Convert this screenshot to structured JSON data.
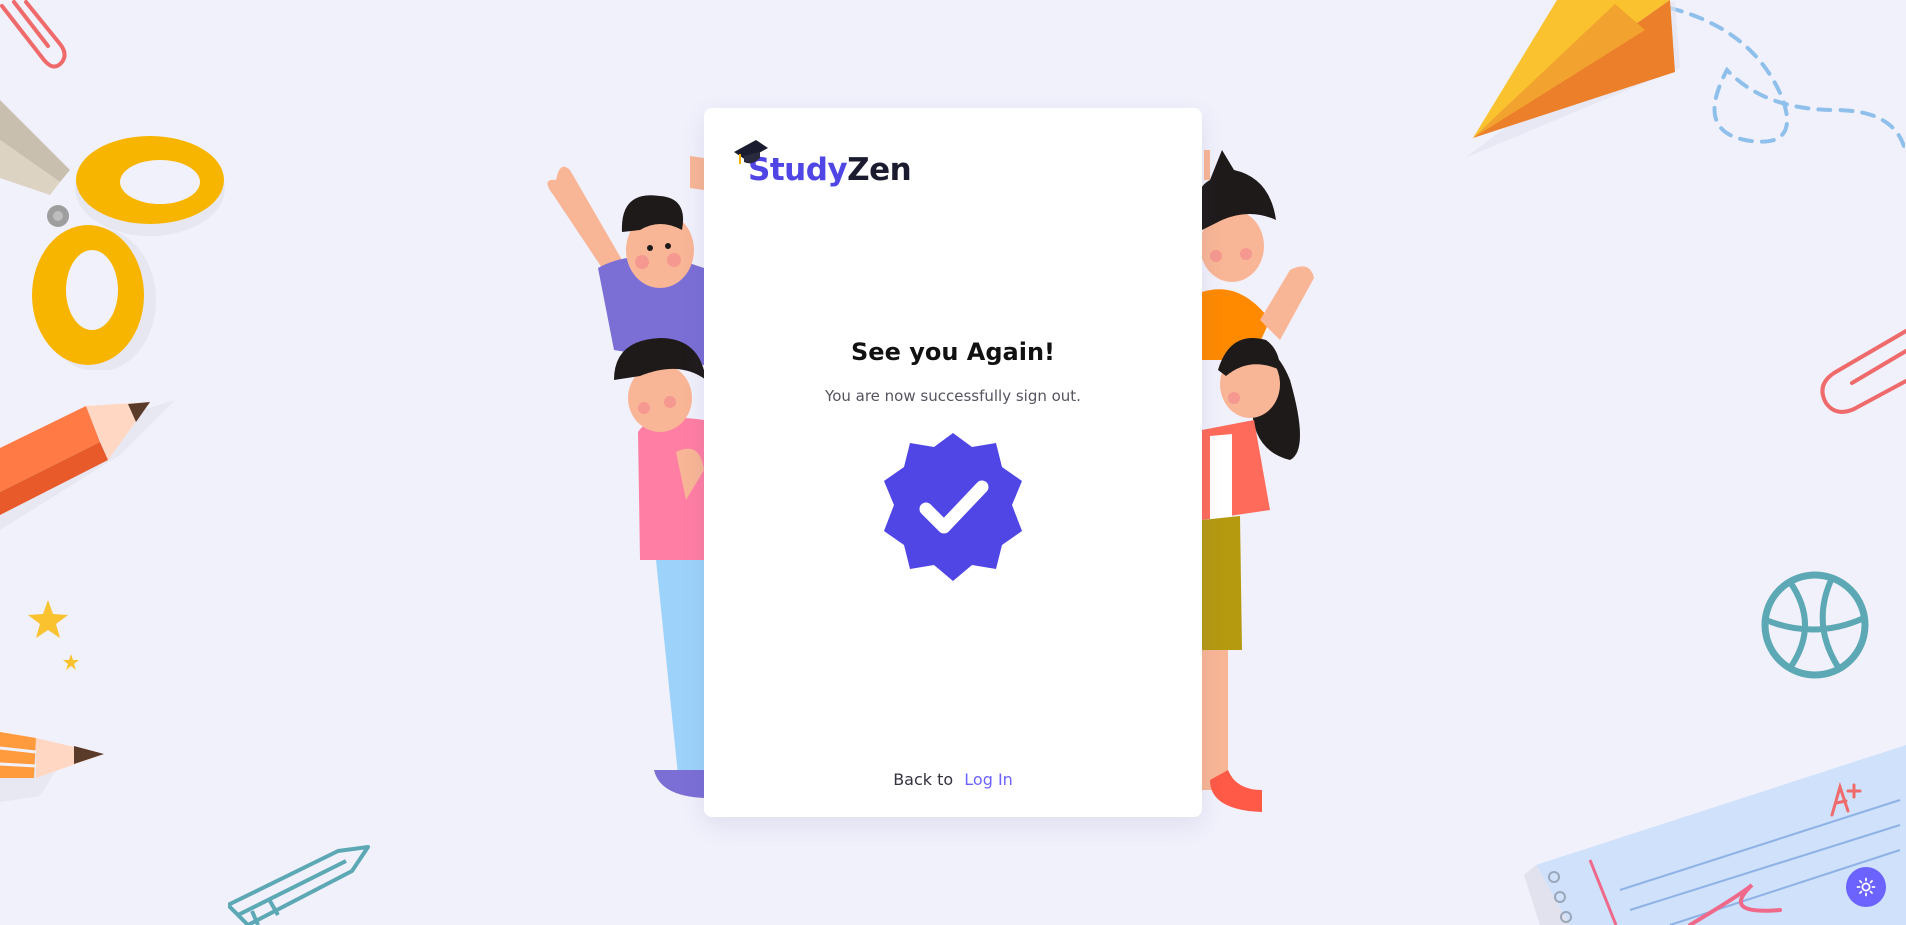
{
  "brand": {
    "name_part1": "Study",
    "name_part2": "Zen",
    "primary_color": "#4f46e5",
    "dark_color": "#1b1b2f"
  },
  "card": {
    "title": "See you Again!",
    "subtitle": "You are now successfully sign out.",
    "badge_icon": "check-badge-icon",
    "back_prefix": "Back to",
    "back_link_label": "Log In",
    "link_color": "#6c63ff"
  },
  "theme_toggle": {
    "icon": "sun-icon",
    "color": "#6c63ff"
  },
  "decorations": [
    "paperclip-icon",
    "scissors-icon",
    "pencil-icon",
    "star-icon",
    "paper-plane-icon",
    "basketball-icon",
    "notebook-icon",
    "students-illustration"
  ],
  "background_color": "#f1f1fc"
}
